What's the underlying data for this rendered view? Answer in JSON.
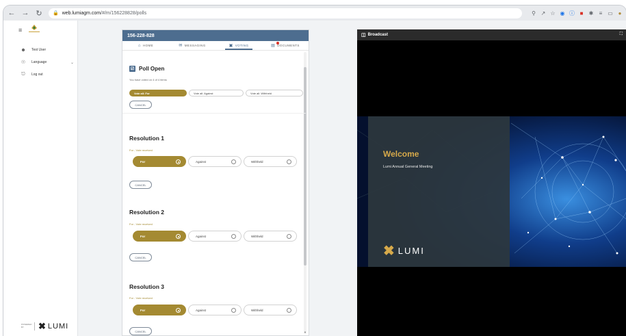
{
  "browser": {
    "url_host": "web.lumiagm.com",
    "url_path": "/#/m/156228828/polls"
  },
  "sidebar": {
    "items": [
      {
        "label": "Test User",
        "icon": "account-circle-icon"
      },
      {
        "label": "Language",
        "icon": "globe-icon"
      },
      {
        "label": "Log out",
        "icon": "logout-icon"
      }
    ],
    "powered_by": "POWERED BY",
    "lumi_brand": "LUMI"
  },
  "poll_panel": {
    "meeting_id": "156-228-828",
    "tabs": [
      {
        "label": "HOME",
        "icon": "home-icon"
      },
      {
        "label": "MESSAGING",
        "icon": "chat-icon"
      },
      {
        "label": "VOTING",
        "icon": "ballot-icon"
      },
      {
        "label": "DOCUMENTS",
        "icon": "document-icon"
      }
    ],
    "active_tab": "VOTING",
    "poll_status": "Poll Open",
    "voted_count": "You have voted on 4 of 4 items",
    "vote_all": {
      "for": "Vote all: For",
      "against": "Vote all: Against",
      "withheld": "Vote all: Withheld"
    },
    "cancel_label": "CANCEL",
    "resolutions": [
      {
        "title": "Resolution 1",
        "status": "For - Vote received",
        "options": [
          "For",
          "Against",
          "Withheld"
        ],
        "selected": "For"
      },
      {
        "title": "Resolution 2",
        "status": "For - Vote received",
        "options": [
          "For",
          "Against",
          "Withheld"
        ],
        "selected": "For"
      },
      {
        "title": "Resolution 3",
        "status": "For - Vote received",
        "options": [
          "For",
          "Against",
          "Withheld"
        ],
        "selected": "For"
      }
    ]
  },
  "broadcast": {
    "header": "Broadcast",
    "slide_title": "Welcome",
    "slide_subtitle": "Lumi Annual General Meeting",
    "slide_brand": "LUMI"
  },
  "colors": {
    "accent_gold": "#a48a32",
    "header_blue": "#4d6d8f",
    "slide_gold": "#d6a94a"
  }
}
